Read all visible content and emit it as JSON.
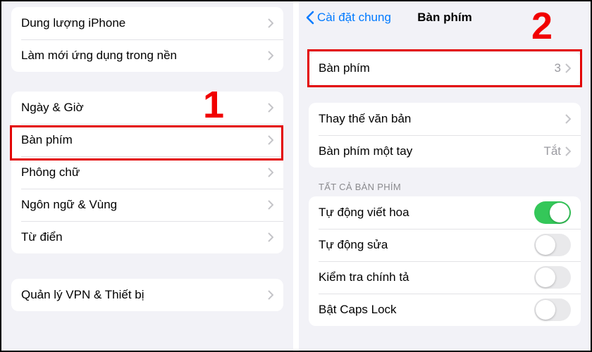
{
  "annotations": {
    "step1": "1",
    "step2": "2"
  },
  "left": {
    "group1": {
      "storage": "Dung lượng iPhone",
      "background_refresh": "Làm mới ứng dụng trong nền"
    },
    "group2": {
      "date_time": "Ngày & Giờ",
      "keyboard": "Bàn phím",
      "fonts": "Phông chữ",
      "lang_region": "Ngôn ngữ & Vùng",
      "dictionary": "Từ điển"
    },
    "group3": {
      "vpn_device": "Quản lý VPN & Thiết bị"
    }
  },
  "right": {
    "nav": {
      "back": "Cài đặt chung",
      "title": "Bàn phím"
    },
    "g1": {
      "keyboards_label": "Bàn phím",
      "keyboards_count": "3"
    },
    "g2": {
      "text_replace": "Thay thế văn bản",
      "one_handed": "Bàn phím một tay",
      "one_handed_value": "Tắt"
    },
    "section_header": "TẤT CẢ BÀN PHÍM",
    "g3": {
      "auto_cap": {
        "label": "Tự động viết hoa",
        "on": true
      },
      "auto_correct": {
        "label": "Tự động sửa",
        "on": false
      },
      "spell_check": {
        "label": "Kiểm tra chính tả",
        "on": false
      },
      "caps_lock": {
        "label": "Bật Caps Lock",
        "on": false
      }
    }
  }
}
